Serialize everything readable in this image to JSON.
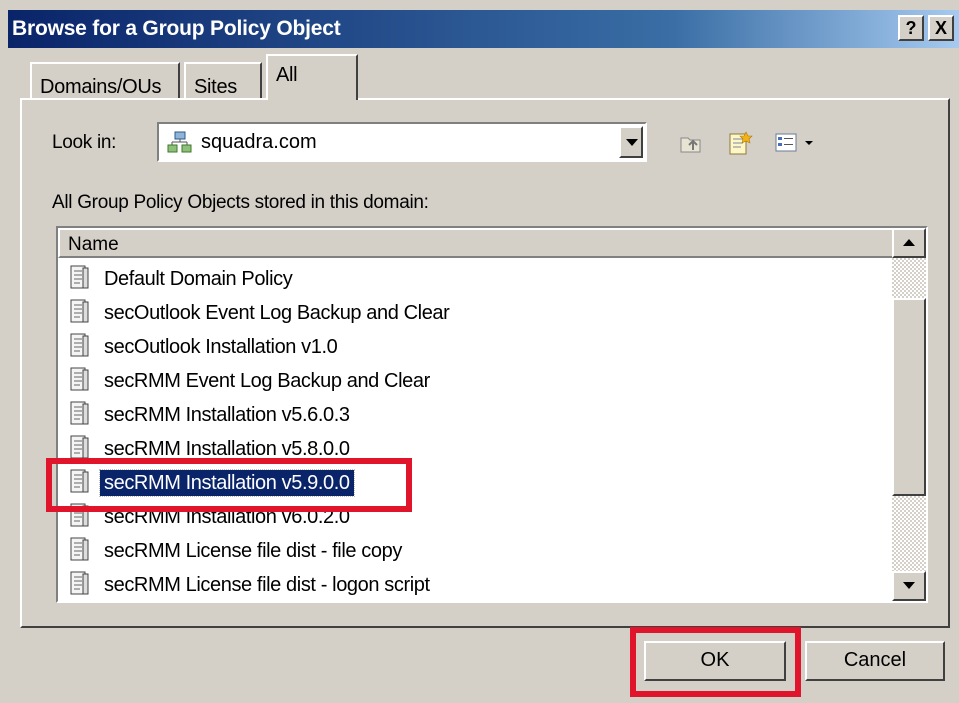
{
  "window": {
    "title": "Browse for a Group Policy Object",
    "help_label": "?",
    "close_label": "X"
  },
  "tabs": [
    {
      "label": "Domains/OUs",
      "active": false
    },
    {
      "label": "Sites",
      "active": false
    },
    {
      "label": "All",
      "active": true
    }
  ],
  "look_in": {
    "label": "Look in:",
    "value": "squadra.com",
    "icon": "domain-icon"
  },
  "toolbar": {
    "icons": [
      "up-one-level-icon",
      "new-gpo-icon",
      "view-menu-icon"
    ]
  },
  "list": {
    "caption": "All Group Policy Objects stored in this domain:",
    "column_header": "Name",
    "items": [
      {
        "label": "Default Domain Policy",
        "selected": false
      },
      {
        "label": "secOutlook Event Log Backup and Clear",
        "selected": false
      },
      {
        "label": "secOutlook Installation v1.0",
        "selected": false
      },
      {
        "label": "secRMM Event Log Backup and Clear",
        "selected": false
      },
      {
        "label": "secRMM Installation v5.6.0.3",
        "selected": false
      },
      {
        "label": "secRMM Installation v5.8.0.0",
        "selected": false
      },
      {
        "label": "secRMM Installation v5.9.0.0",
        "selected": true
      },
      {
        "label": "secRMM Installation v6.0.2.0",
        "selected": false
      },
      {
        "label": "secRMM License file dist - file copy",
        "selected": false
      },
      {
        "label": "secRMM License file dist - logon script",
        "selected": false
      }
    ]
  },
  "buttons": {
    "ok": "OK",
    "cancel": "Cancel"
  },
  "colors": {
    "highlight": "#e0152b",
    "selection": "#0a246a",
    "dialog_face": "#d4d0c8"
  }
}
